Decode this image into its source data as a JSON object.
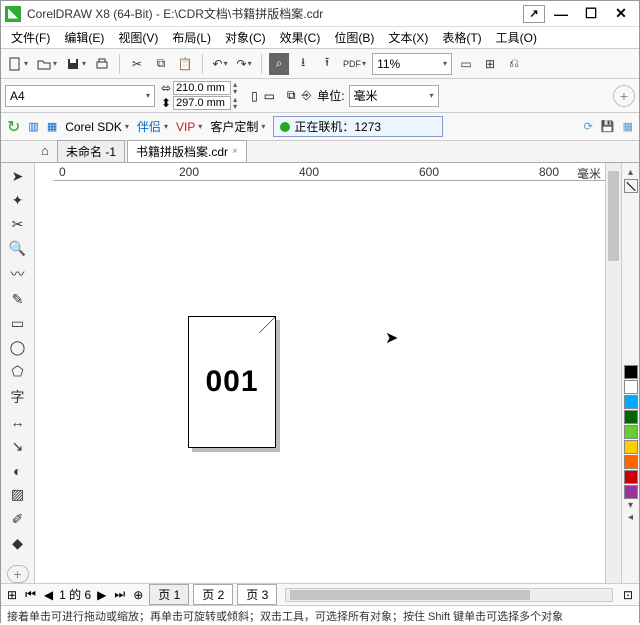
{
  "title": "CorelDRAW X8 (64-Bit) - E:\\CDR文档\\书籍拼版档案.cdr",
  "menu": [
    "文件(F)",
    "编辑(E)",
    "视图(V)",
    "布局(L)",
    "对象(C)",
    "效果(C)",
    "位图(B)",
    "文本(X)",
    "表格(T)",
    "工具(O)"
  ],
  "toolbar1": {
    "zoom_pct": "11%"
  },
  "toolbar2": {
    "pagesize": "A4",
    "width": "210.0 mm",
    "height": "297.0 mm",
    "unit_label": "单位:",
    "unit_value": "毫米"
  },
  "plugbar": {
    "items": [
      "Corel SDK",
      "伴侣",
      "VIP",
      "客户定制"
    ],
    "online_text": "正在联机：1273"
  },
  "doctabs": {
    "untitled": "未命名 -1",
    "current": "书籍拼版档案.cdr"
  },
  "ruler_marks": [
    "0",
    "200",
    "400",
    "600",
    "800"
  ],
  "ruler_unit": "毫米",
  "page_number": "001",
  "pagenav": {
    "info": "1 的 6",
    "tabs": [
      "页 1",
      "页 2",
      "页 3"
    ]
  },
  "hint": "接着单击可进行拖动或缩放；再单击可旋转或倾斜；双击工具，可选择所有对象；按住 Shift 键单击可选择多个对象",
  "palette": [
    "#000000",
    "#ffffff",
    "#00aaff",
    "#006633",
    "#66cc33",
    "#ffcc00",
    "#ff6600",
    "#cc0000",
    "#993399"
  ]
}
